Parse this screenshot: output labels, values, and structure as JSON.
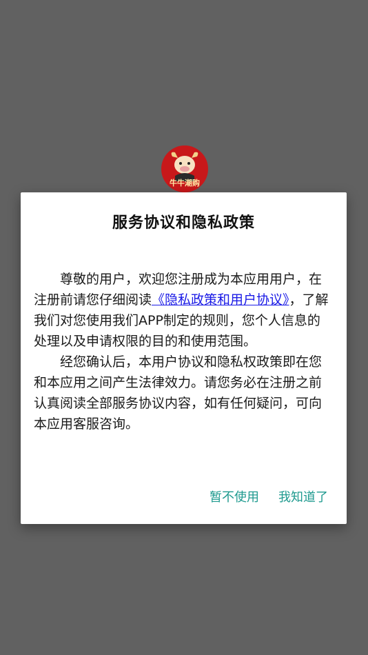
{
  "app": {
    "logo_text": "牛牛潮购"
  },
  "dialog": {
    "title": "服务协议和隐私政策",
    "paragraph1_before_link": "尊敬的用户，欢迎您注册成为本应用用户，在注册前请您仔细阅读",
    "link_text": "《隐私政策和用户协议》",
    "paragraph1_after_link": "，了解我们对您使用我们APP制定的规则，您个人信息的处理以及申请权限的目的和使用范围。",
    "paragraph2": "经您确认后，本用户协议和隐私权政策即在您和本应用之间产生法律效力。请您务必在注册之前认真阅读全部服务协议内容，如有任何疑问，可向本应用客服咨询。",
    "decline_label": "暂不使用",
    "accept_label": "我知道了"
  },
  "colors": {
    "scrim": "#616161",
    "link": "#1a1ae6",
    "action": "#1f9a8f",
    "logo_bg": "#c8181a"
  }
}
